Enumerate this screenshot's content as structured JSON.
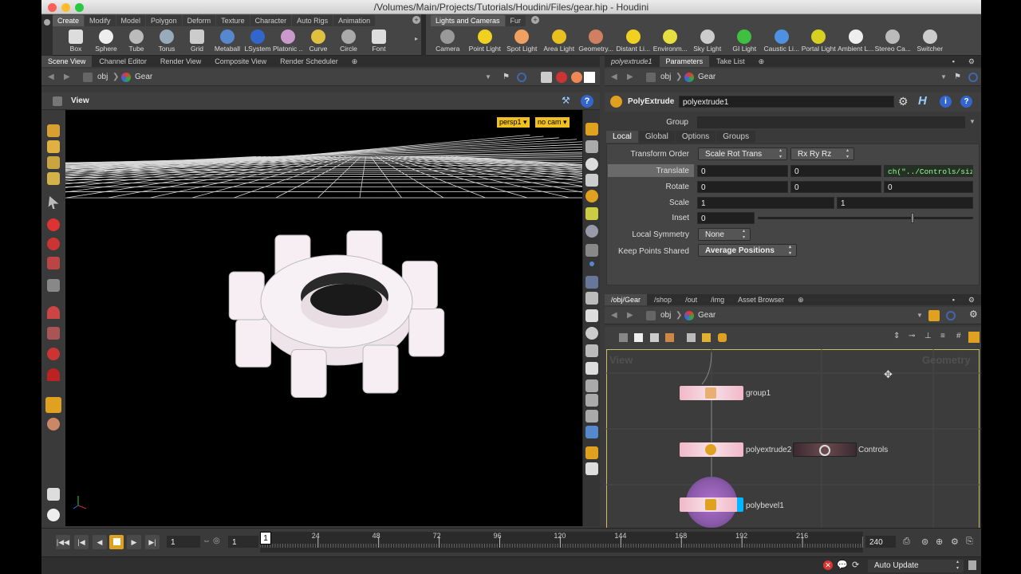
{
  "window": {
    "title": "/Volumes/Main/Projects/Tutorials/Houdini/Files/gear.hip - Houdini"
  },
  "shelf_left": {
    "tabs": [
      "Create",
      "Modify",
      "Model",
      "Polygon",
      "Deform",
      "Texture",
      "Character",
      "Auto Rigs",
      "Animation"
    ],
    "tools": [
      "Box",
      "Sphere",
      "Tube",
      "Torus",
      "Grid",
      "Metaball",
      "LSystem",
      "Platonic ...",
      "Curve",
      "Circle",
      "Font"
    ]
  },
  "shelf_right": {
    "tabs": [
      "Lights and Cameras",
      "Fur"
    ],
    "tools": [
      "Camera",
      "Point Light",
      "Spot Light",
      "Area Light",
      "Geometry...",
      "Distant Li...",
      "Environm...",
      "Sky Light",
      "GI Light",
      "Caustic Li...",
      "Portal Light",
      "Ambient L...",
      "Stereo Ca...",
      "Switcher"
    ]
  },
  "left_pane": {
    "tabs": [
      "Scene View",
      "Channel Editor",
      "Render View",
      "Composite View",
      "Render Scheduler"
    ],
    "path": {
      "root": "obj",
      "node": "Gear"
    },
    "view_label": "View",
    "cam_persp": "persp1 ▾",
    "cam_nocam": "no cam ▾"
  },
  "params_pane": {
    "tabs": [
      "polyextrude1",
      "Parameters",
      "Take List"
    ],
    "path": {
      "root": "obj",
      "node": "Gear"
    },
    "node_type": "PolyExtrude",
    "node_name": "polyextrude1",
    "group_label": "Group",
    "subtabs": [
      "Local",
      "Global",
      "Options",
      "Groups"
    ],
    "transform_order_label": "Transform Order",
    "transform_order": "Scale Rot Trans",
    "rotate_order": "Rx Ry Rz",
    "translate_label": "Translate",
    "translate": [
      "0",
      "0",
      "ch(\"../Controls/siz"
    ],
    "rotate_label": "Rotate",
    "rotate": [
      "0",
      "0",
      "0"
    ],
    "scale_label": "Scale",
    "scale": [
      "1",
      "1"
    ],
    "inset_label": "Inset",
    "inset": "0",
    "inset_slider": 0.72,
    "local_symmetry_label": "Local Symmetry",
    "local_symmetry": "None",
    "keep_points_label": "Keep Points Shared",
    "keep_points": "Average Positions"
  },
  "network_pane": {
    "tabs": [
      "/obj/Gear",
      "/shop",
      "/out",
      "/img",
      "Asset Browser"
    ],
    "path": {
      "root": "obj",
      "node": "Gear"
    },
    "watermark_left": "View",
    "watermark_right": "Geometry",
    "nodes": [
      "group1",
      "polyextrude2",
      "Controls",
      "polybevel1"
    ]
  },
  "timeline": {
    "current_frame": "1",
    "start": "1",
    "start2": "1",
    "end": "240",
    "playhead": "1",
    "ticks": [
      "24",
      "48",
      "72",
      "96",
      "120",
      "144",
      "168",
      "192",
      "216"
    ]
  },
  "status": {
    "update_mode": "Auto Update"
  },
  "colors": {
    "accent": "#e8a000",
    "node_pink": "#f0c8d0",
    "selected_cyan": "#00b8ff",
    "bypass_purple": "#8a5aa8"
  }
}
